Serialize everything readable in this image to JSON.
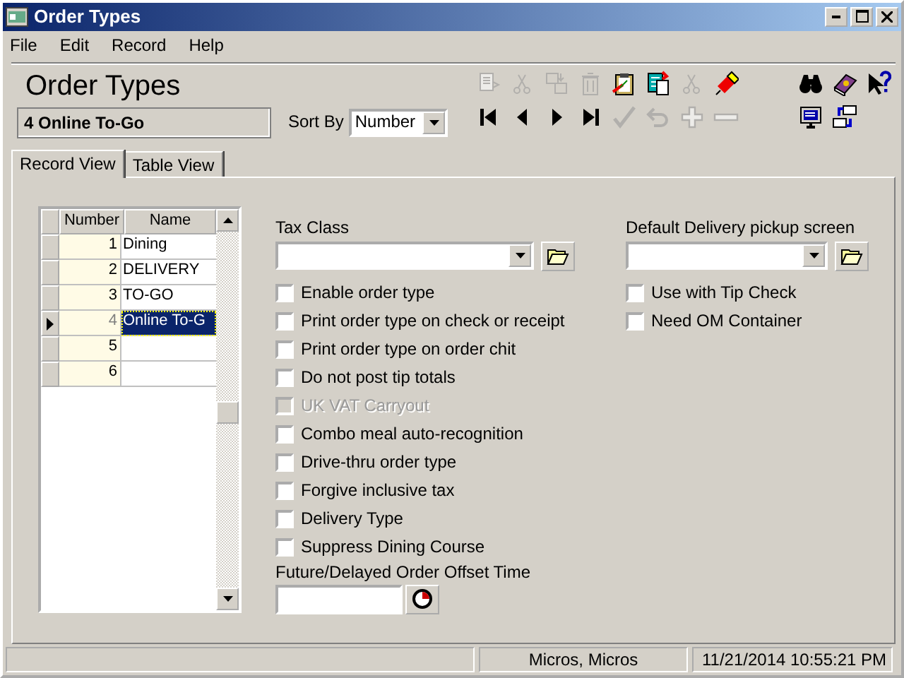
{
  "window": {
    "title": "Order Types"
  },
  "menu": [
    {
      "label": "File"
    },
    {
      "label": "Edit"
    },
    {
      "label": "Record"
    },
    {
      "label": "Help"
    }
  ],
  "header": {
    "title": "Order Types",
    "record": "4  Online To-Go",
    "sort_label": "Sort By",
    "sort_value": "Number"
  },
  "toolbar_rows": [
    {
      "main": [
        {
          "kind": "copy",
          "disabled": true
        },
        {
          "kind": "cut",
          "disabled": true
        },
        {
          "kind": "merge",
          "disabled": true
        },
        {
          "kind": "trash",
          "disabled": true
        },
        {
          "kind": "clipboard",
          "disabled": false
        },
        {
          "kind": "document",
          "disabled": false
        },
        {
          "kind": "cut",
          "disabled": true
        },
        {
          "kind": "eraser",
          "disabled": false
        }
      ],
      "right": [
        {
          "kind": "binoculars",
          "disabled": false
        },
        {
          "kind": "book",
          "disabled": false
        },
        {
          "kind": "help",
          "disabled": false
        }
      ]
    },
    {
      "main": [
        {
          "kind": "first",
          "disabled": false
        },
        {
          "kind": "prev",
          "disabled": false
        },
        {
          "kind": "next",
          "disabled": false
        },
        {
          "kind": "last",
          "disabled": false
        },
        {
          "kind": "check",
          "disabled": true
        },
        {
          "kind": "undo",
          "disabled": true
        },
        {
          "kind": "plus",
          "disabled": true
        },
        {
          "kind": "minus",
          "disabled": true
        }
      ],
      "right": [
        {
          "kind": "monitor",
          "disabled": false
        },
        {
          "kind": "sync",
          "disabled": false
        }
      ]
    }
  ],
  "tabs": [
    {
      "label": "Record View",
      "selected": true
    },
    {
      "label": "Table View",
      "selected": false
    }
  ],
  "grid": {
    "columns": [
      "Number",
      "Name"
    ],
    "rows": [
      {
        "number": "1",
        "name": "Dining",
        "selected": false
      },
      {
        "number": "2",
        "name": "DELIVERY",
        "selected": false
      },
      {
        "number": "3",
        "name": "TO-GO",
        "selected": false
      },
      {
        "number": "4",
        "name": "Online To-G",
        "selected": true
      },
      {
        "number": "5",
        "name": "",
        "selected": false
      },
      {
        "number": "6",
        "name": "",
        "selected": false
      }
    ]
  },
  "tax_class": {
    "label": "Tax Class"
  },
  "options_left": [
    {
      "label": "Enable order type",
      "checked": false,
      "disabled": false
    },
    {
      "label": "Print order type on check or receipt",
      "checked": false,
      "disabled": false
    },
    {
      "label": "Print order type on order chit",
      "checked": false,
      "disabled": false
    },
    {
      "label": "Do not post tip totals",
      "checked": false,
      "disabled": false
    },
    {
      "label": "UK VAT Carryout",
      "checked": false,
      "disabled": true
    },
    {
      "label": "Combo meal auto-recognition",
      "checked": false,
      "disabled": false
    },
    {
      "label": "Drive-thru order type",
      "checked": false,
      "disabled": false
    },
    {
      "label": "Forgive inclusive tax",
      "checked": false,
      "disabled": false
    },
    {
      "label": "Delivery Type",
      "checked": false,
      "disabled": false
    },
    {
      "label": "Suppress Dining Course",
      "checked": false,
      "disabled": false
    }
  ],
  "offset_time": {
    "label": "Future/Delayed Order Offset Time"
  },
  "delivery_screen": {
    "label": "Default Delivery pickup screen"
  },
  "options_right": [
    {
      "label": "Use with Tip Check",
      "checked": false,
      "disabled": false
    },
    {
      "label": "Need OM Container",
      "checked": false,
      "disabled": false
    }
  ],
  "status_bar": {
    "user": "Micros, Micros",
    "datetime": "11/21/2014 10:55:21 PM"
  }
}
